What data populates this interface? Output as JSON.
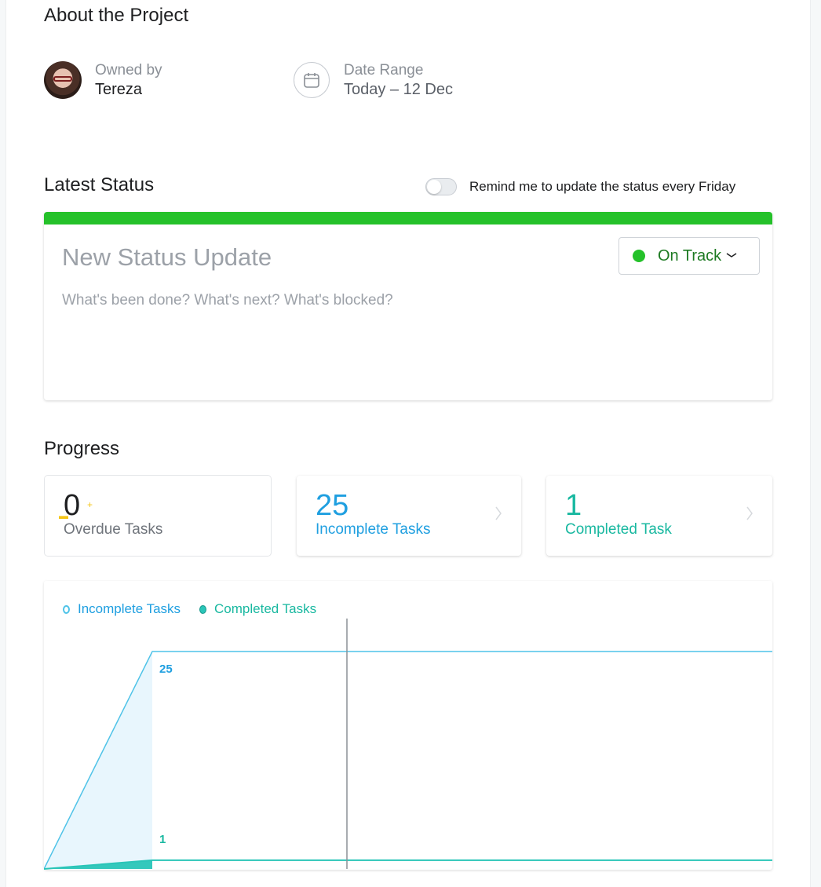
{
  "about": {
    "title": "About the Project",
    "owner_label": "Owned by",
    "owner_name": "Tereza",
    "date_label": "Date Range",
    "date_value": "Today – 12 Dec"
  },
  "status": {
    "title": "Latest Status",
    "remind_label": "Remind me to update the status every Friday",
    "remind_enabled": false,
    "new_title_placeholder": "New Status Update",
    "body_placeholder": "What's been done? What's next? What's blocked?",
    "state_label": "On Track",
    "state_color": "#25c12a"
  },
  "progress": {
    "title": "Progress",
    "overdue_count": "0",
    "overdue_label": "Overdue Tasks",
    "incomplete_count": "25",
    "incomplete_label": "Incomplete Tasks",
    "completed_count": "1",
    "completed_label": "Completed Task"
  },
  "chart_data": {
    "type": "area",
    "legend": [
      "Incomplete Tasks",
      "Completed Tasks"
    ],
    "series": [
      {
        "name": "Incomplete Tasks",
        "color": "#4fc3e8",
        "values": [
          0,
          25,
          25
        ],
        "end_label": "25"
      },
      {
        "name": "Completed Tasks",
        "color": "#2ac5b8",
        "values": [
          0,
          1,
          1
        ],
        "end_label": "1"
      }
    ],
    "ylim": [
      0,
      26
    ],
    "grid": false,
    "legend_position": "top-left",
    "today_marker": true
  }
}
